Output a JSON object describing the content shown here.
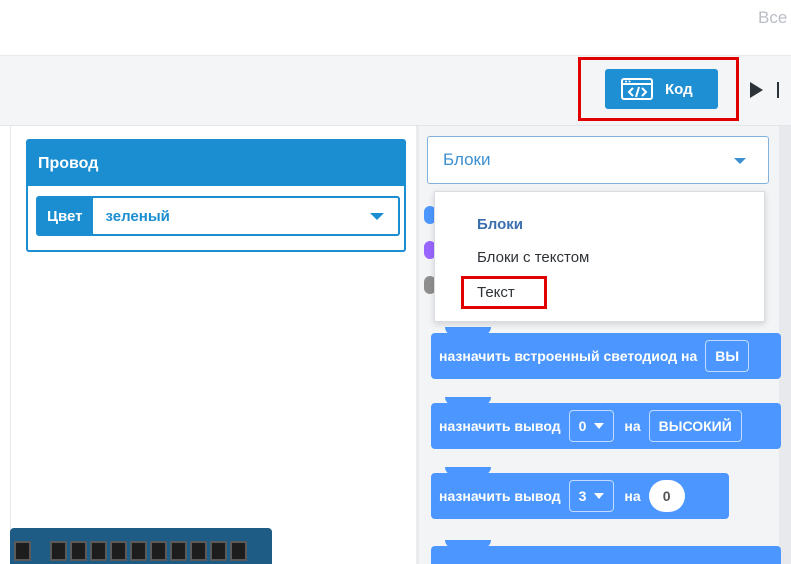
{
  "header": {
    "top_link": "Все"
  },
  "toolbar": {
    "code_label": "Код",
    "play_tail": ""
  },
  "wire_panel": {
    "title": "Провод",
    "color_label": "Цвет",
    "color_value": "зеленый"
  },
  "mode_select": {
    "value": "Блоки",
    "options": [
      "Блоки",
      "Блоки с текстом",
      "Текст"
    ],
    "selected_index": 0
  },
  "categories": [
    {
      "color": "#4c97ff"
    },
    {
      "color": "#9966ff"
    },
    {
      "color": "#8f8f8f"
    }
  ],
  "blocks": [
    {
      "text": "назначить встроенный светодиод на",
      "value": "ВЫ"
    },
    {
      "text": "назначить вывод",
      "pin": "0",
      "on_word": "на",
      "value": "ВЫСОКИЙ"
    },
    {
      "text": "назначить вывод",
      "pin": "3",
      "on_word": "на",
      "value": "0"
    }
  ],
  "colors": {
    "accent": "#1b8ed1",
    "block": "#4c97ff",
    "highlight": "#e00000"
  }
}
